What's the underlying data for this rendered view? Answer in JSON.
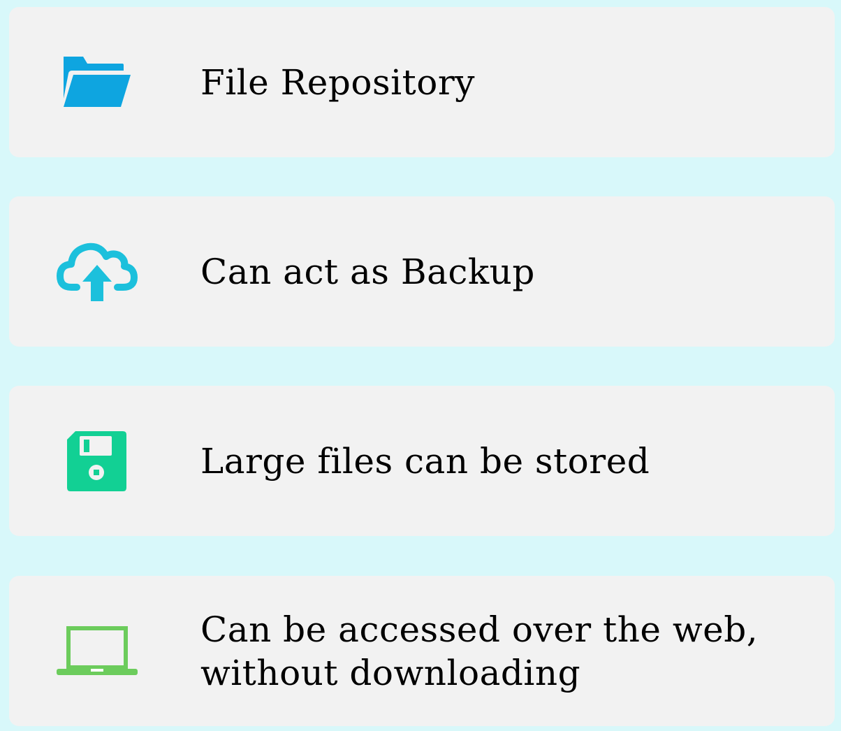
{
  "features": [
    {
      "icon": "folder-icon",
      "text": "File Repository",
      "color": "#0ea5e0"
    },
    {
      "icon": "cloud-upload-icon",
      "text": "Can act as Backup",
      "color": "#1cc0dc"
    },
    {
      "icon": "floppy-disk-icon",
      "text": "Large files can be stored",
      "color": "#12d094"
    },
    {
      "icon": "laptop-icon",
      "text": "Can be accessed over the web,\nwithout downloading",
      "color": "#6ccc5c"
    }
  ]
}
